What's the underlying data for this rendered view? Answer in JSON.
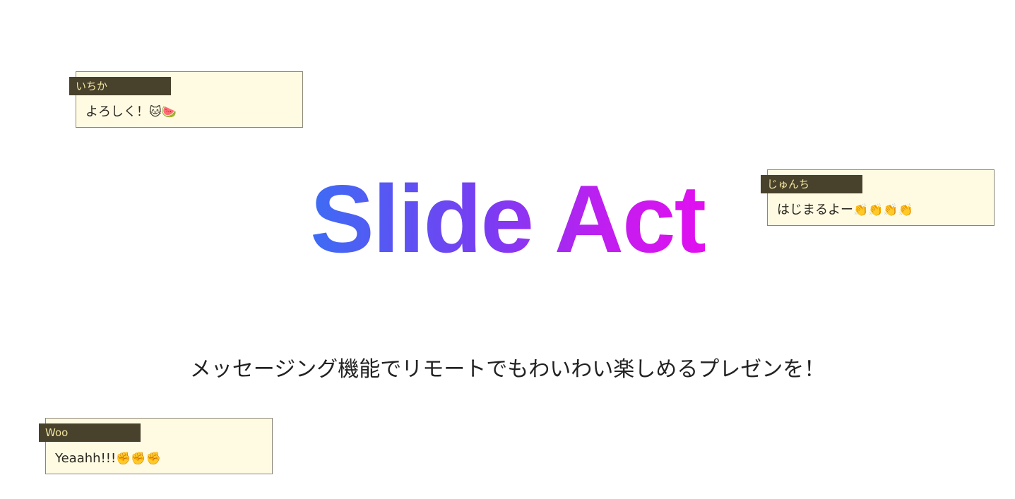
{
  "slide": {
    "title": "Slide Act",
    "subtitle": "メッセージング機能でリモートでもわいわい楽しめるプレゼンを！"
  },
  "messages": [
    {
      "name": "いちか",
      "text": "よろしく！",
      "emoji": "🐱🍉"
    },
    {
      "name": "じゅんち",
      "text": "はじまるよー",
      "emoji": "👏👏👏👏"
    },
    {
      "name": "Woo",
      "text": "Yeaahh!!!",
      "emoji": "✊✊✊"
    }
  ],
  "colors": {
    "title_gradient_start": "#3d6cf4",
    "title_gradient_end": "#e20ff0",
    "message_background": "#fffbe3",
    "name_tag_background": "#48412b",
    "name_tag_text": "#f0e3a0"
  }
}
